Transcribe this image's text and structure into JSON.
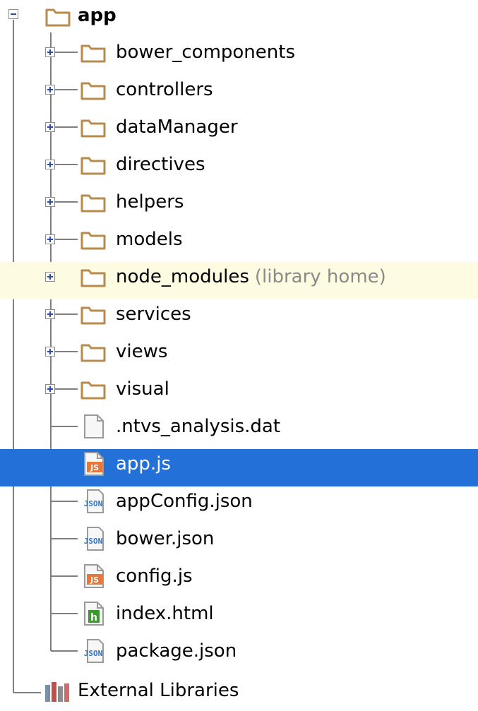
{
  "tree": {
    "root": {
      "label": "app",
      "expanded": true,
      "icon": "folder-icon"
    },
    "items": [
      {
        "label": "bower_components",
        "type": "folder",
        "icon": "folder-icon"
      },
      {
        "label": "controllers",
        "type": "folder",
        "icon": "folder-icon"
      },
      {
        "label": "dataManager",
        "type": "folder",
        "icon": "folder-icon"
      },
      {
        "label": "directives",
        "type": "folder",
        "icon": "folder-icon"
      },
      {
        "label": "helpers",
        "type": "folder",
        "icon": "folder-icon"
      },
      {
        "label": "models",
        "type": "folder",
        "icon": "folder-icon"
      },
      {
        "label": "node_modules",
        "hint": "(library home)",
        "type": "folder",
        "icon": "folder-icon",
        "highlighted": true
      },
      {
        "label": "services",
        "type": "folder",
        "icon": "folder-icon"
      },
      {
        "label": "views",
        "type": "folder",
        "icon": "folder-icon"
      },
      {
        "label": "visual",
        "type": "folder",
        "icon": "folder-icon"
      },
      {
        "label": ".ntvs_analysis.dat",
        "type": "file",
        "icon": "file-icon"
      },
      {
        "label": "app.js",
        "type": "file",
        "icon": "js-file-icon",
        "icon_text": "JS",
        "selected": true
      },
      {
        "label": "appConfig.json",
        "type": "file",
        "icon": "json-file-icon",
        "icon_text": "JSON"
      },
      {
        "label": "bower.json",
        "type": "file",
        "icon": "json-file-icon",
        "icon_text": "JSON"
      },
      {
        "label": "config.js",
        "type": "file",
        "icon": "js-file-icon",
        "icon_text": "JS"
      },
      {
        "label": "index.html",
        "type": "file",
        "icon": "html-file-icon",
        "icon_text": "h"
      },
      {
        "label": "package.json",
        "type": "file",
        "icon": "json-file-icon",
        "icon_text": "JSON"
      }
    ],
    "external": {
      "label": "External Libraries",
      "icon": "library-icon"
    }
  },
  "colors": {
    "selection": "#2270d8",
    "highlight_row": "#fdfbe1",
    "folder_stroke": "#b88a4c",
    "js_icon": "#e9773a",
    "json_icon": "#2b73c9",
    "html_icon": "#3a9a2f",
    "guide_line": "#7f7f7f",
    "hint_text": "#8a8a8a"
  }
}
